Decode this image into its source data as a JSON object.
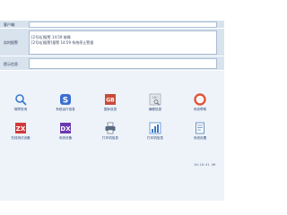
{
  "header": {
    "user_label": "客户端:"
  },
  "alarm": {
    "label": "实时报警",
    "lines": [
      "[2号站]报警 14:59 故障",
      "[2号站]报警]报警 14:59 系统停止警报"
    ]
  },
  "prompt": {
    "label": "提示信息",
    "text": ""
  },
  "icons": [
    {
      "name": "search-icon",
      "label": "故障查询",
      "color": "#3a78c9"
    },
    {
      "name": "s-icon",
      "label": "系统运行信息",
      "color": "#3a6fd1"
    },
    {
      "name": "gb-icon",
      "label": "国标信息",
      "color": "#c94a3a"
    },
    {
      "name": "abc-icon",
      "label": "编程信息",
      "color": "#8a8f99"
    },
    {
      "name": "lifebuoy-icon",
      "label": "系统帮助",
      "color": "#e0553b"
    },
    {
      "name": "zx-icon",
      "label": "在线测试设备",
      "color": "#d13a3a"
    },
    {
      "name": "dx-icon",
      "label": "系统设备",
      "color": "#6a3ab0"
    },
    {
      "name": "printer-icon",
      "label": "打印机信息",
      "color": "#5a6a80"
    },
    {
      "name": "chart-icon",
      "label": "打印机信息",
      "color": "#3a78c9"
    },
    {
      "name": "document-icon",
      "label": "系统设置",
      "color": "#4a7ab0"
    }
  ],
  "status": {
    "time": "10:10:41 AM"
  }
}
